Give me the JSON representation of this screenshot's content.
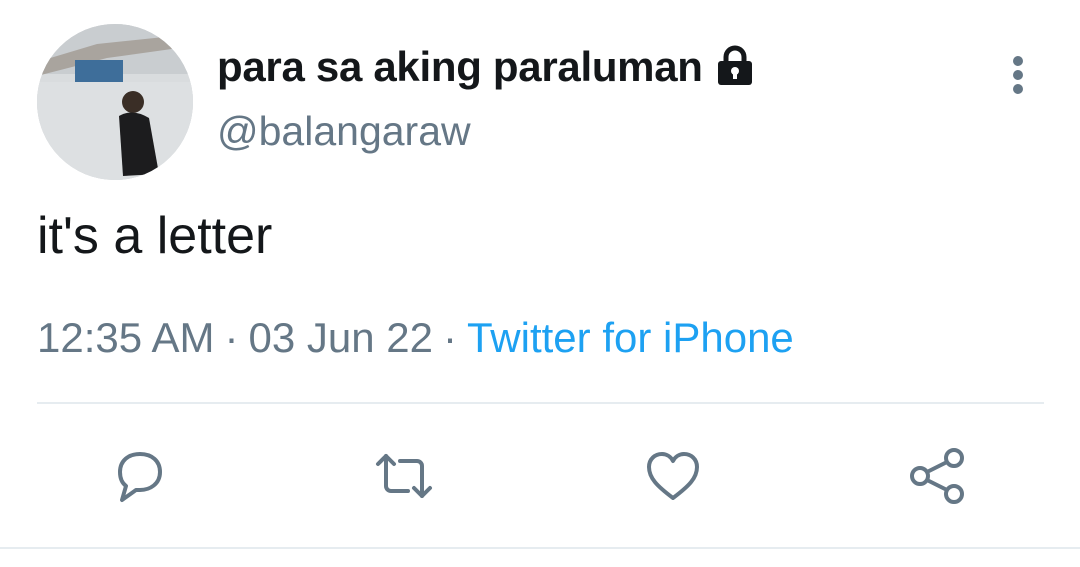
{
  "user": {
    "display_name": "para sa aking paraluman",
    "handle": "@balangaraw",
    "protected_icon": "lock-icon"
  },
  "tweet": {
    "text": "it's a letter",
    "time": "12:35 AM",
    "date": "03 Jun 22",
    "separator": "·",
    "source": "Twitter for iPhone"
  },
  "actions": {
    "reply_icon": "reply-icon",
    "retweet_icon": "retweet-icon",
    "like_icon": "heart-icon",
    "share_icon": "share-icon"
  },
  "colors": {
    "text": "#14171a",
    "secondary": "#657786",
    "accent": "#1da1f2",
    "divider": "#e6ecf0"
  }
}
